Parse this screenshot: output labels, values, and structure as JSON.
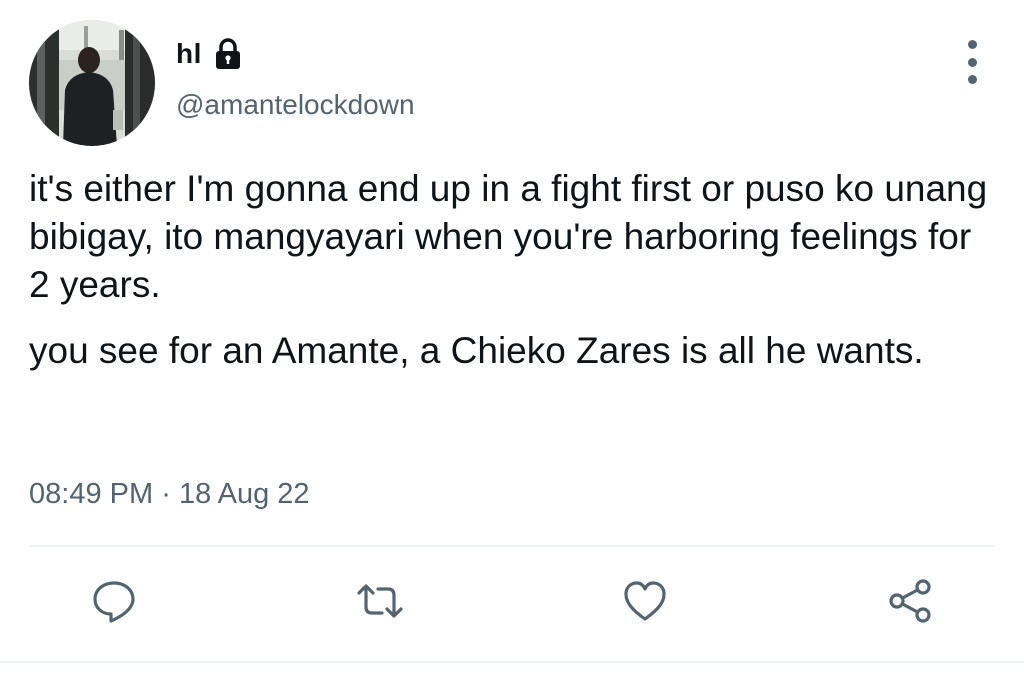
{
  "author": {
    "display_name": "hl",
    "handle": "@amantelockdown",
    "protected_icon": "lock-icon",
    "avatar_icon": "avatar-photo"
  },
  "tweet": {
    "paragraphs": [
      "it's either I'm gonna end up in a fight first or puso ko unang bibigay, ito mangyayari when you're harboring feelings for 2 years.",
      "you see for an Amante, a Chieko Zares is all he wants."
    ],
    "time": "08:49 PM",
    "separator": "·",
    "date": "18 Aug 22"
  },
  "actions": [
    {
      "name": "reply",
      "icon": "comment-icon"
    },
    {
      "name": "retweet",
      "icon": "retweet-icon"
    },
    {
      "name": "like",
      "icon": "heart-icon"
    },
    {
      "name": "share",
      "icon": "share-icon"
    }
  ],
  "colors": {
    "text": "#0f1419",
    "secondary": "#536471",
    "divider": "#eff3f4"
  }
}
